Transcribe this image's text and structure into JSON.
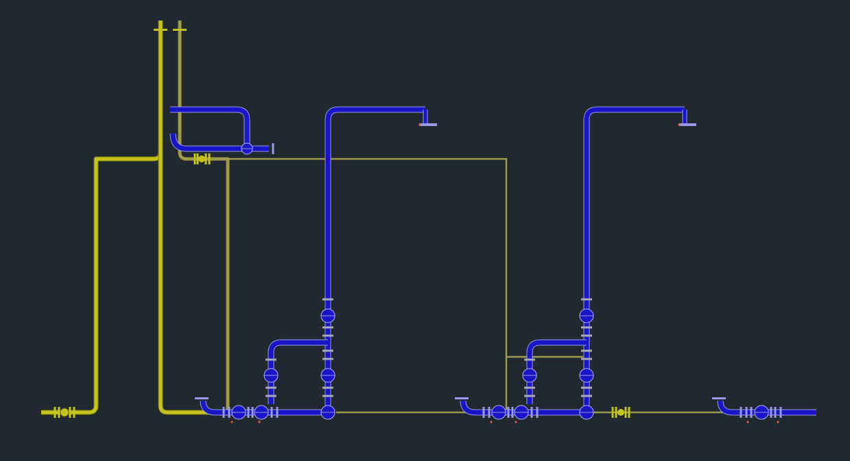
{
  "drawing": {
    "background": "#212830",
    "colors": {
      "water_pipe": "#1a16c8",
      "water_edge": "#9a9ae8",
      "gas_pipe_bright": "#c4c41e",
      "gas_pipe_dim": "#9c9a4e",
      "flange": "#a8a8b8",
      "marker": "#e05a4a"
    },
    "layers": [
      "water-lines",
      "gas-lines",
      "valves",
      "flanges",
      "pump-units",
      "vents"
    ],
    "pump_units": [
      "pump-unit-1",
      "pump-unit-2",
      "pump-unit-3"
    ]
  }
}
